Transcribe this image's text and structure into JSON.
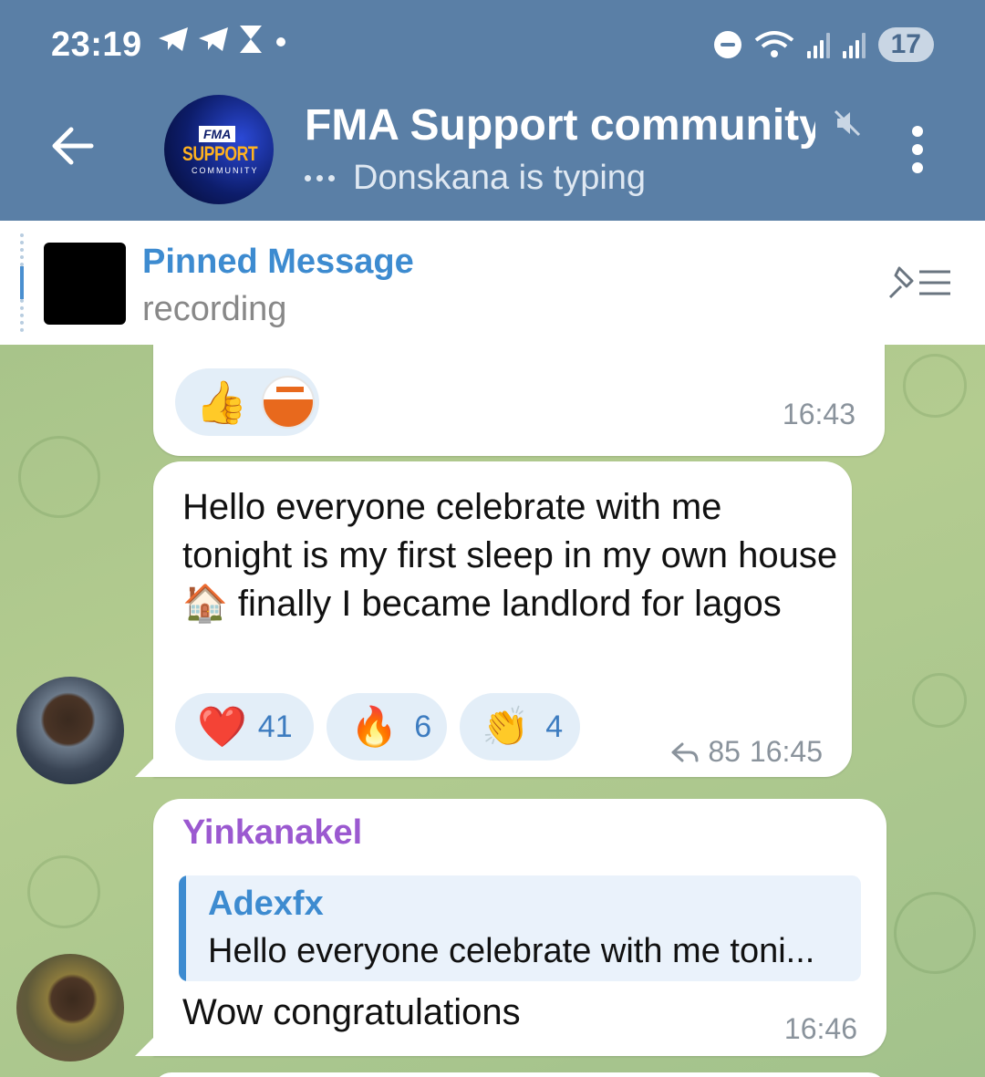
{
  "status_bar": {
    "time": "23:19",
    "battery": "17"
  },
  "header": {
    "group_avatar": {
      "line1": "FMA",
      "line2": "SUPPORT",
      "line3": "COMMUNITY"
    },
    "title": "FMA Support community",
    "subtitle": "Donskana is typing"
  },
  "pinned": {
    "title": "Pinned Message",
    "text": "recording"
  },
  "messages": [
    {
      "reactions": [
        {
          "emoji": "👍"
        },
        {
          "emoji": "sticker"
        }
      ],
      "time": "16:43"
    },
    {
      "text": "Hello everyone celebrate with me tonight is my first sleep in my own house 🏠  finally I became landlord for lagos",
      "reactions": [
        {
          "emoji": "❤️",
          "count": "41"
        },
        {
          "emoji": "🔥",
          "count": "6"
        },
        {
          "emoji": "👏",
          "count": "4"
        }
      ],
      "forwards": "85",
      "time": "16:45"
    },
    {
      "sender": "Yinkanakel",
      "reply_to": {
        "name": "Adexfx",
        "text": "Hello everyone celebrate with me toni..."
      },
      "text": "Wow congratulations",
      "time": "16:46"
    }
  ],
  "colors": {
    "header_bg": "#5a7fa6",
    "accent": "#3d8bd0",
    "sender_name": "#9b59d0",
    "chat_bg": "#a9c48a"
  }
}
